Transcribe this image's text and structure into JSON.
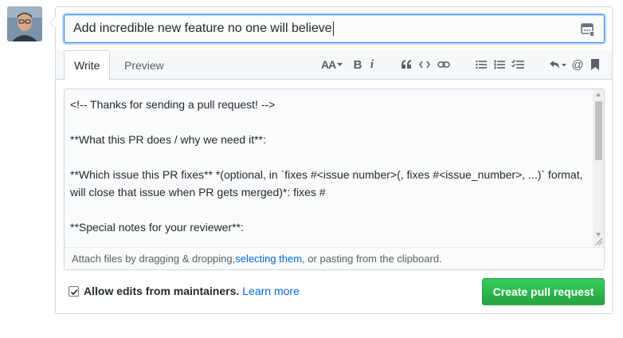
{
  "title_input": {
    "value": "Add incredible new feature no one will believe"
  },
  "tabs": [
    {
      "label": "Write",
      "active": true
    },
    {
      "label": "Preview",
      "active": false
    }
  ],
  "toolbar": {
    "icons": [
      "text-size-icon",
      "bold-icon",
      "italic-icon",
      "quote-icon",
      "code-icon",
      "link-icon",
      "bulleted-list-icon",
      "numbered-list-icon",
      "task-list-icon",
      "reply-icon",
      "mention-icon",
      "bookmark-icon"
    ],
    "text_size_label": "AA",
    "bold_label": "B",
    "italic_label": "i",
    "mention_label": "@"
  },
  "body_text": "<!-- Thanks for sending a pull request! -->\n\n**What this PR does / why we need it**:\n\n**Which issue this PR fixes** *(optional, in `fixes #<issue number>(, fixes #<issue_number>, ...)` format, will close that issue when PR gets merged)*: fixes #\n\n**Special notes for your reviewer**:",
  "attach_bar": {
    "prefix": "Attach files by dragging & dropping, ",
    "link": "selecting them",
    "suffix": ", or pasting from the clipboard."
  },
  "footer": {
    "allow_edits_label": "Allow edits from maintainers.",
    "allow_edits_checked": true,
    "learn_more": "Learn more",
    "submit_label": "Create pull request"
  },
  "colors": {
    "primary_green": "#28a745",
    "link_blue": "#0366d6",
    "focus_blue": "#2188ff",
    "border": "#d1d5da"
  }
}
